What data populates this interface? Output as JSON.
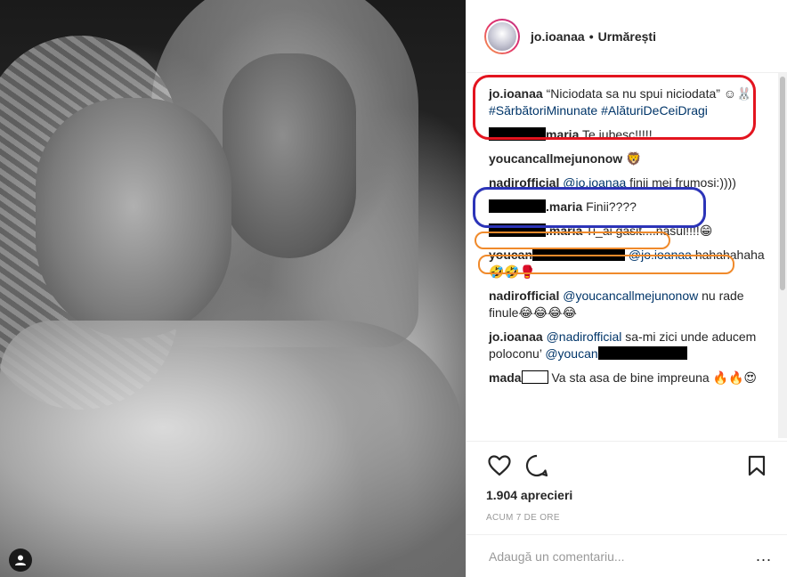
{
  "post": {
    "username": "jo.ioanaa",
    "follow_status": "Urmărești",
    "separator": "•"
  },
  "comments": [
    {
      "user": "jo.ioanaa",
      "parts": [
        {
          "t": "text",
          "v": " “Niciodata sa nu spui niciodata” ☺🐰 "
        },
        {
          "t": "tag",
          "v": "#SărbătoriMinunate"
        },
        {
          "t": "text",
          "v": " "
        },
        {
          "t": "tag",
          "v": "#AlăturiDeCeiDragi"
        }
      ]
    },
    {
      "user": "maria",
      "user_redact": "pre",
      "parts": [
        {
          "t": "text",
          "v": " Te iubesc!!!!!"
        }
      ]
    },
    {
      "user": "youcancallmejunonow",
      "parts": [
        {
          "t": "text",
          "v": " 🦁"
        }
      ]
    },
    {
      "user": "nadirofficial",
      "parts": [
        {
          "t": "mention",
          "v": " @jo.ioanaa"
        },
        {
          "t": "text",
          "v": " finii mei frumosi:))))"
        }
      ]
    },
    {
      "user": ".maria",
      "user_redact": "pre",
      "parts": [
        {
          "t": "text",
          "v": " Finii????"
        }
      ]
    },
    {
      "user": ".maria",
      "user_redact": "pre",
      "parts": [
        {
          "t": "text",
          "v": " Ti_ai gasit....nasul!!!!😁"
        }
      ]
    },
    {
      "user": "youcan",
      "user_redact": "post",
      "parts": [
        {
          "t": "mention",
          "v": " @jo.ioanaa"
        },
        {
          "t": "text",
          "v": " hahahahaha 🤣🤣🥊"
        }
      ]
    },
    {
      "user": "nadirofficial",
      "parts": [
        {
          "t": "mention",
          "v": " @youcancallmejunonow"
        },
        {
          "t": "text",
          "v": " nu rade finule😂😂😂😂"
        }
      ]
    },
    {
      "user": "jo.ioanaa",
      "parts": [
        {
          "t": "mention",
          "v": " @nadirofficial"
        },
        {
          "t": "text",
          "v": " sa-mi zici unde aducem poloconu’ "
        },
        {
          "t": "mention",
          "v": "@youcan"
        },
        {
          "t": "redact",
          "v": ""
        }
      ]
    },
    {
      "user": "mada",
      "user_redact": "post_box",
      "parts": [
        {
          "t": "text",
          "v": " Va sta asa de bine impreuna 🔥🔥😍"
        }
      ]
    }
  ],
  "actions": {
    "likes": "1.904 aprecieri",
    "time": "ACUM 7 DE ORE"
  },
  "add_comment": {
    "placeholder": "Adaugă un comentariu...",
    "more": "..."
  },
  "colors": {
    "annotation_red": "#e3141f",
    "annotation_blue": "#2c34b8",
    "annotation_orange": "#f08a2b",
    "link": "#003569"
  }
}
